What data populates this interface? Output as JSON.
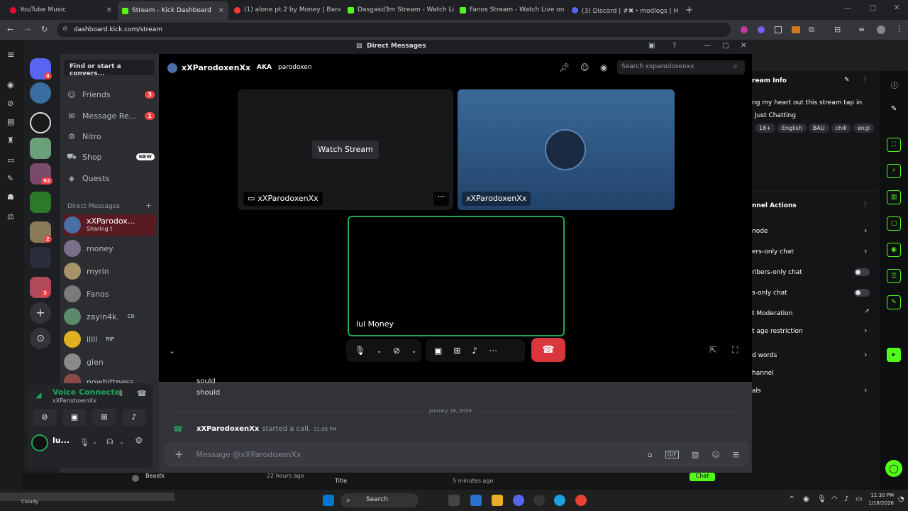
{
  "browser": {
    "tabs": [
      {
        "label": "YouTube Music",
        "color": "#ff0033"
      },
      {
        "label": "Stream - Kick Dashboard",
        "color": "#53fc18"
      },
      {
        "label": "(1) alone pt.2 by Money | Band",
        "color": "#ff3b30"
      },
      {
        "label": "Dasgasd3m Stream - Watch Liv",
        "color": "#53fc18"
      },
      {
        "label": "Fanos Stream - Watch Live on K",
        "color": "#53fc18"
      },
      {
        "label": "(3) Discord | #✖・modlogs | Hol",
        "color": "#5865f2"
      }
    ],
    "url": "dashboard.kick.com/stream"
  },
  "discord": {
    "window_title": "Direct Messages",
    "search_placeholder": "Find or start a convers...",
    "nav": [
      {
        "label": "Friends",
        "icon": "friends-icon",
        "count": "3"
      },
      {
        "label": "Message Re...",
        "icon": "message-requests-icon",
        "count": "1"
      },
      {
        "label": "Nitro",
        "icon": "nitro-icon"
      },
      {
        "label": "Shop",
        "icon": "shop-icon",
        "tag": "NEW"
      },
      {
        "label": "Quests",
        "icon": "quests-icon"
      }
    ],
    "dm_header": "Direct Messages",
    "dms": [
      {
        "name": "xXParodox...",
        "sub": "Sharing t",
        "color": "#4a6fa5"
      },
      {
        "name": "money",
        "color": "#7a6f8a"
      },
      {
        "name": "myrin",
        "color": "#a8926a"
      },
      {
        "name": "Fanos",
        "color": "#7a7a7a"
      },
      {
        "name": "zayin4k.",
        "tag": "CR",
        "color": "#5a8a6a"
      },
      {
        "name": "lllll",
        "tag": "RIP",
        "color": "#e0b020"
      },
      {
        "name": "glen",
        "color": "#8a8a8a"
      },
      {
        "name": "nowhittness",
        "color": "#8a4a4a"
      }
    ],
    "guild_badges": [
      "4",
      "92",
      "2",
      "3"
    ],
    "voice": {
      "status": "Voice Connecte",
      "channel": "xXParodoxenXx"
    },
    "user": {
      "name": "lu..."
    },
    "channel": {
      "name": "xXParodoxenXx",
      "aka_label": "AKA",
      "aka": "parodoxen",
      "search_placeholder": "Search xxparodoxenxx"
    },
    "tiles": [
      {
        "label": "xXParodoxenXx",
        "button": "Watch Stream"
      },
      {
        "label": "xXParodoxenXx"
      },
      {
        "label": "lul Money"
      }
    ],
    "messages": [
      {
        "text": "sould"
      },
      {
        "text": "should"
      }
    ],
    "date_divider": "January 18, 2026",
    "call_event": {
      "user": "xXParodoxenXx",
      "text": "started a call.",
      "time": "11:08 PM"
    },
    "message_placeholder": "Message @xXParodoxenXx"
  },
  "kick": {
    "stream_info_title": "ream Info",
    "stream_title_text": "ng my heart out this stream tap in",
    "category": "Just Chatting",
    "tags": [
      "18+",
      "English",
      "BAU",
      "chill",
      "engl"
    ],
    "channel_actions_title": "nnel Actions",
    "actions": [
      {
        "label": "node",
        "kind": "chevron"
      },
      {
        "label": "ers-only chat",
        "kind": "chevron"
      },
      {
        "label": "ribers-only chat",
        "kind": "toggle"
      },
      {
        "label": "s-only chat",
        "kind": "toggle"
      },
      {
        "label": "t Moderation",
        "kind": "link"
      },
      {
        "label": "t age restriction",
        "kind": "chevron"
      },
      {
        "label": "d words",
        "kind": "chevron"
      },
      {
        "label": "hannel",
        "kind": "none"
      },
      {
        "label": "als",
        "kind": "chevron"
      }
    ],
    "bottom": {
      "left": "Beastk",
      "mid_time": "22 hours ago",
      "title_label": "Title",
      "right_time": "5 minutes ago",
      "chat_btn": "Chat"
    }
  },
  "taskbar": {
    "search": "Search",
    "time": "11:30 PM",
    "date": "1/18/2026",
    "weather": "Cloudy"
  }
}
